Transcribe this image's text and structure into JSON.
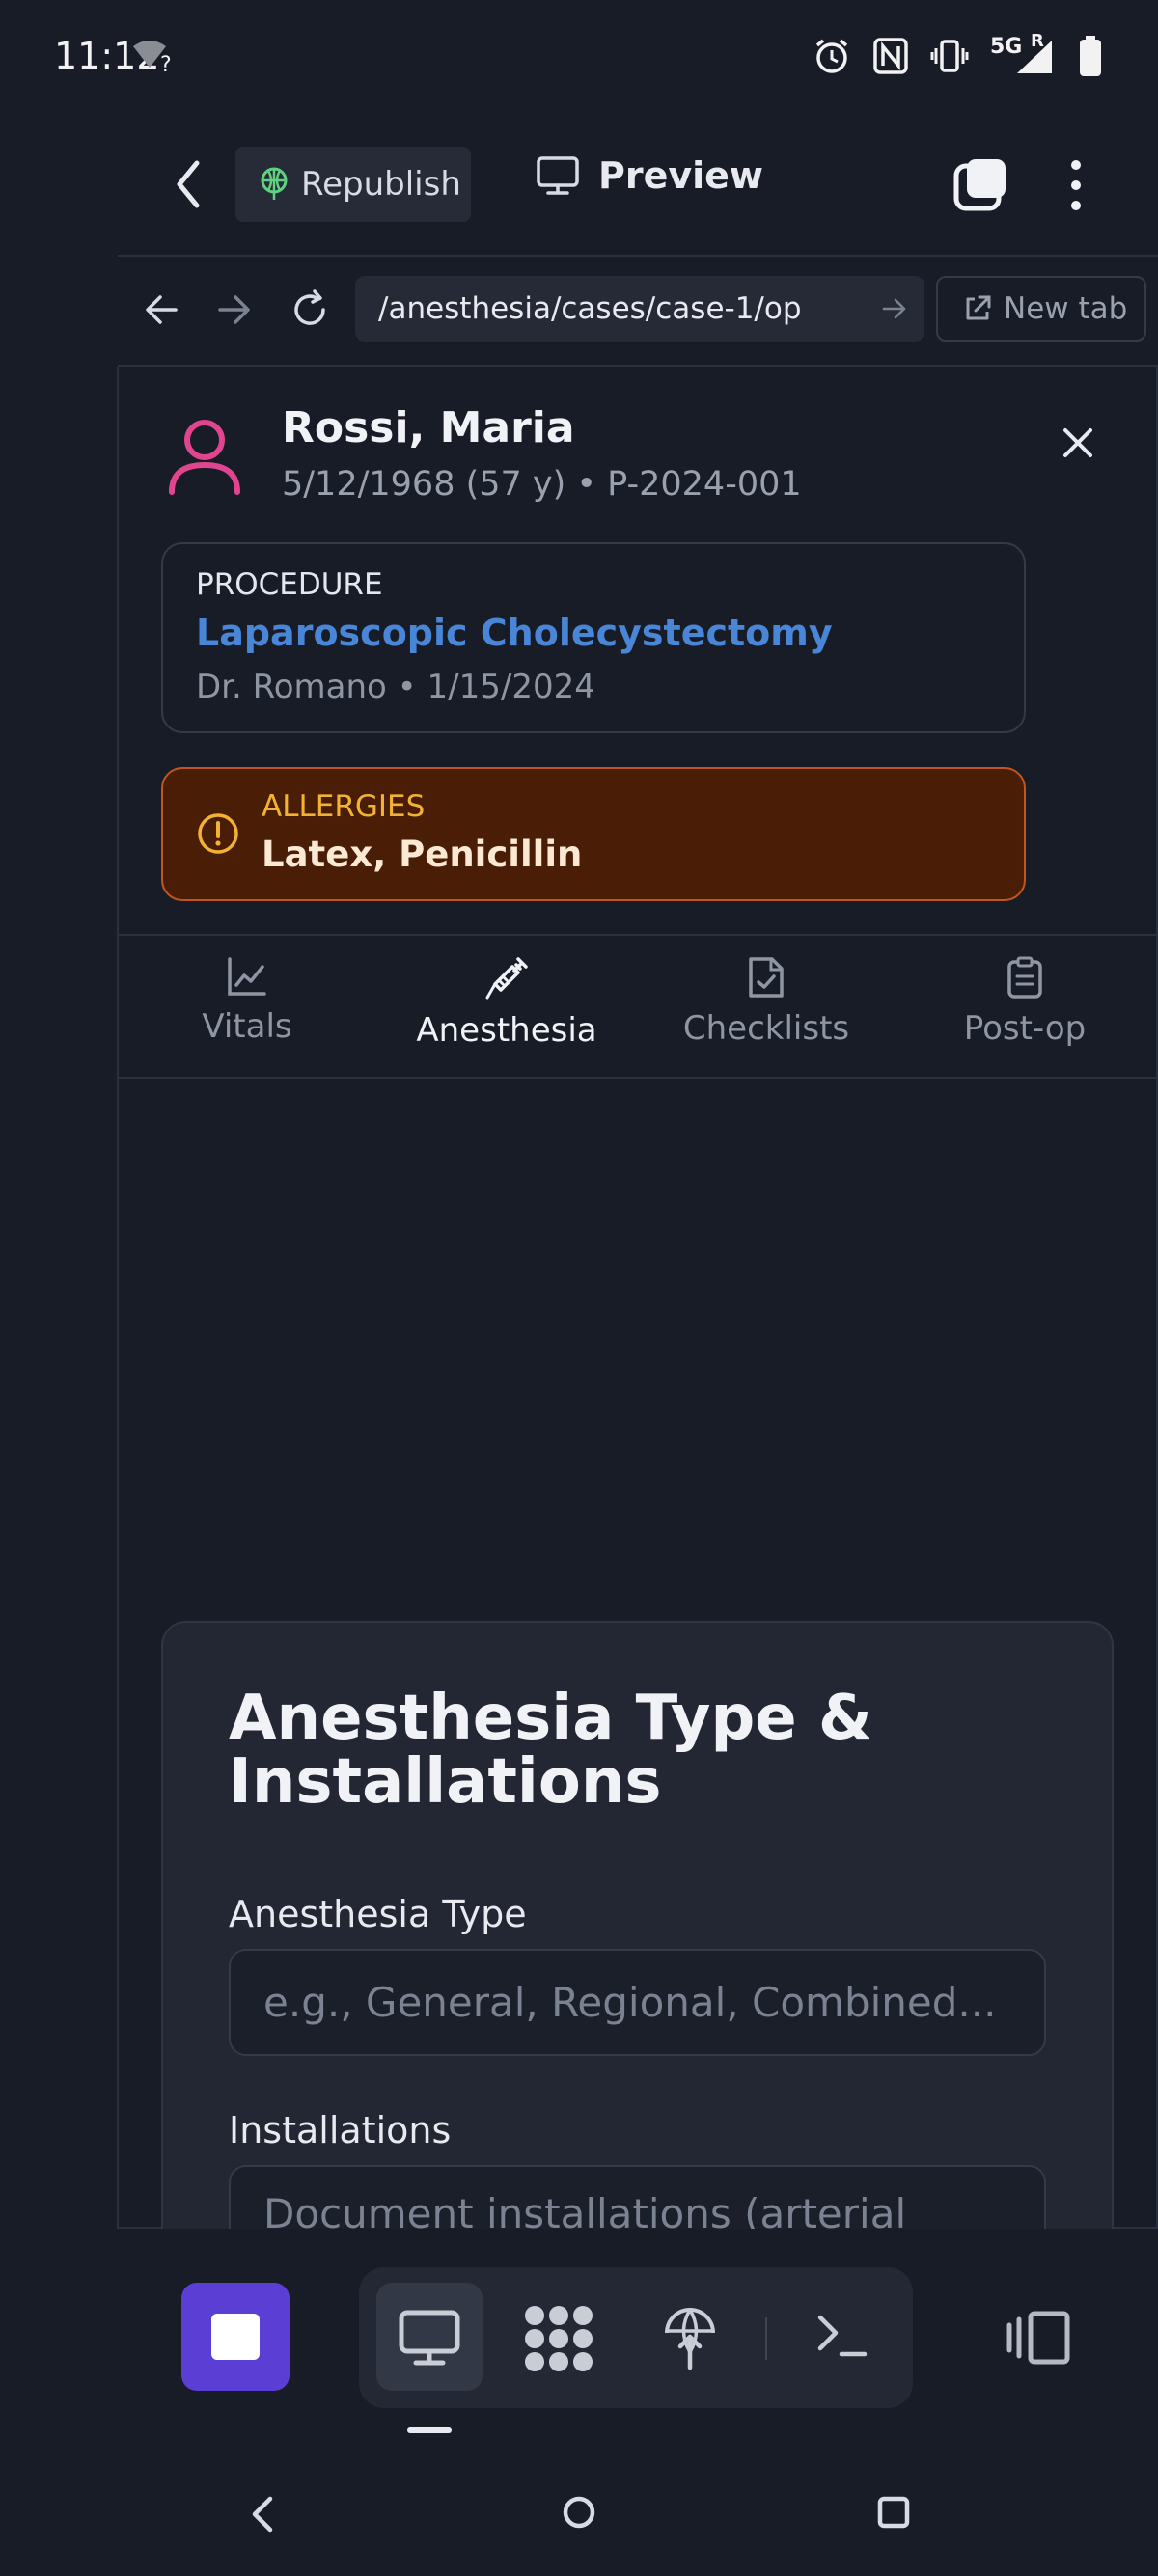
{
  "status_bar": {
    "time": "11:12",
    "wifi_badge": "?",
    "network": "5G",
    "roaming": "R",
    "icons": [
      "wifi-icon",
      "alarm-icon",
      "nfc-icon",
      "vibrate-icon",
      "signal-icon",
      "battery-icon"
    ]
  },
  "app_bar": {
    "republish_label": "Republish",
    "preview_label": "Preview"
  },
  "browser": {
    "url": "/anesthesia/cases/case-1/op",
    "new_tab_label": "New tab"
  },
  "patient": {
    "name": "Rossi, Maria",
    "meta": "5/12/1968 (57 y) • P-2024-001"
  },
  "procedure": {
    "title": "PROCEDURE",
    "name": "Laparoscopic Cholecystectomy",
    "meta": "Dr. Romano • 1/15/2024"
  },
  "allergies": {
    "title": "ALLERGIES",
    "value": "Latex, Penicillin"
  },
  "tabs": [
    {
      "label": "Vitals",
      "icon": "chart-line-icon",
      "active": false
    },
    {
      "label": "Anesthesia",
      "icon": "syringe-icon",
      "active": true
    },
    {
      "label": "Checklists",
      "icon": "file-check-icon",
      "active": false
    },
    {
      "label": "Post-op",
      "icon": "clipboard-icon",
      "active": false
    }
  ],
  "form": {
    "title": "Anesthesia Type & Installations",
    "type_label": "Anesthesia Type",
    "type_placeholder": "e.g., General, Regional, Combined...",
    "install_label": "Installations",
    "install_placeholder": "Document installations (arterial"
  },
  "colors": {
    "background": "#181c27",
    "accent_link": "#4a86d8",
    "avatar": "#e2458f",
    "allergy_bg": "#4a1d07",
    "allergy_border": "#c2571c",
    "allergy_title": "#f2b233",
    "stop_button": "#5b3fd4"
  }
}
